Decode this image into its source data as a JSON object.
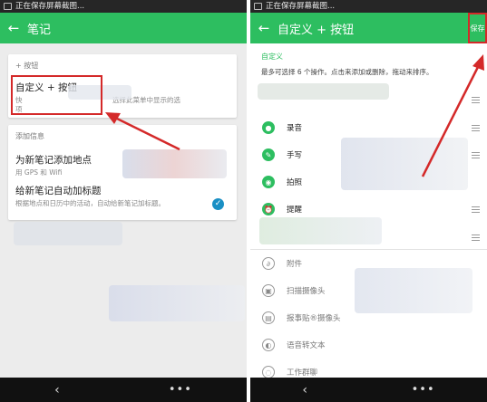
{
  "statusbar": {
    "text": "正在保存屏幕截图..."
  },
  "left": {
    "appbar": {
      "title": "笔记"
    },
    "card1": {
      "section": "+ 按钮",
      "title": "自定义 + 按钮",
      "sub_visible": "快",
      "sub_visible2": "选择此菜单中显示的选",
      "sub_visible3": "项"
    },
    "card2": {
      "section": "添加信息",
      "item1": {
        "title": "为新笔记添加地点",
        "sub": "用 GPS 和 Wifi"
      },
      "item2": {
        "title": "给新笔记自动加标题",
        "sub": "根据地点和日历中的活动，自动给新笔记加标题。"
      }
    }
  },
  "right": {
    "appbar": {
      "title": "自定义 + 按钮",
      "save_label": "保存"
    },
    "section": "自定义",
    "hint": "最多可选择 6 个操作。点击来添加或删除，拖动来排序。",
    "enabled_items": [
      "录音",
      "手写",
      "拍照",
      "提醒"
    ],
    "disabled_items": [
      "附件",
      "扫描摄像头",
      "报事贴®摄像头",
      "语音转文本",
      "工作群聊"
    ]
  },
  "colors": {
    "accent": "#2dbe60",
    "annotation": "#d42929",
    "check": "#1a8fc4"
  }
}
